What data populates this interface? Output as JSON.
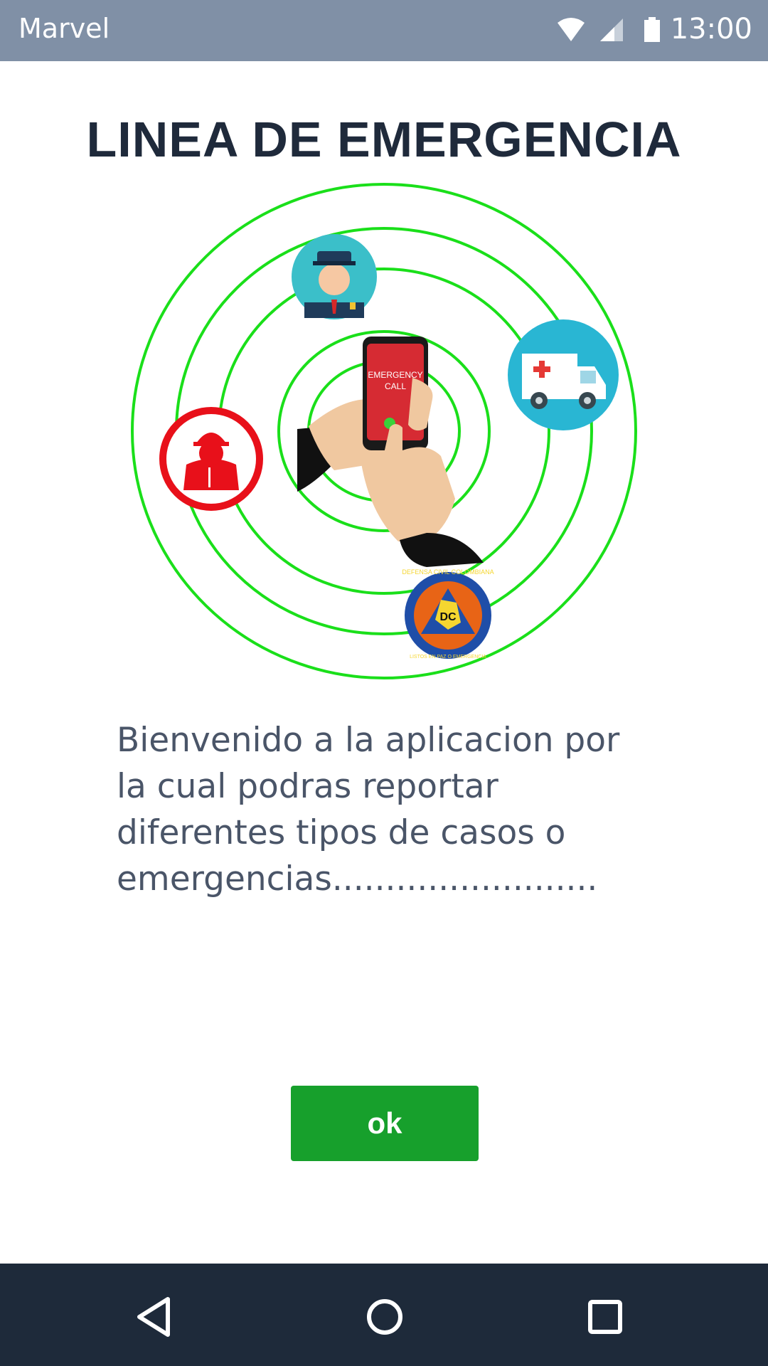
{
  "status_bar": {
    "app_name": "Marvel",
    "time": "13:00",
    "icons": [
      "wifi-icon",
      "signal-icon",
      "battery-icon"
    ]
  },
  "main": {
    "title": "LINEA DE EMERGENCIA",
    "illustration": {
      "phone_text_line1": "EMERGENCY",
      "phone_text_line2": "CALL",
      "badge_text_top": "DEFENSA CIVIL COLOMBIANA",
      "badge_text_center": "DC",
      "badge_text_bottom": "LISTOS EN PAZ O EMERGENCIA"
    },
    "description": "Bienvenido a la aplicacion por la cual podras reportar diferentes tipos de casos o emergencias.........................",
    "ok_label": "ok"
  },
  "nav_bar": {
    "icons": [
      "back-icon",
      "home-icon",
      "recents-icon"
    ]
  },
  "colors": {
    "status_bar": "#8090a6",
    "title": "#1f2a3b",
    "button": "#17a02c",
    "nav_bar": "#1e2a3a",
    "rings": "#1adf1a"
  }
}
